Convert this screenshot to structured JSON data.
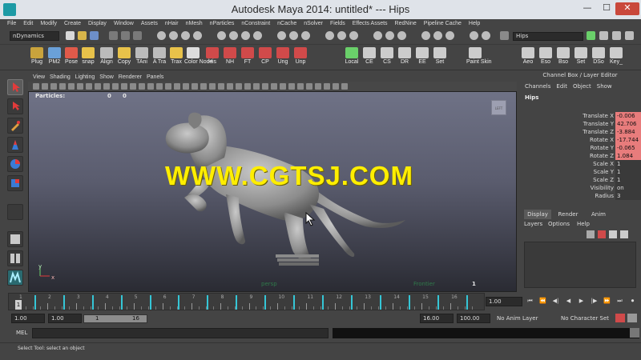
{
  "window": {
    "title": "Autodesk Maya 2014: untitled*   ---   Hips",
    "minimize": "—",
    "maximize": "☐",
    "close": "✕"
  },
  "menu": [
    "File",
    "Edit",
    "Modify",
    "Create",
    "Display",
    "Window",
    "Assets",
    "nHair",
    "nMesh",
    "nParticles",
    "nConstraint",
    "nCache",
    "nSolver",
    "Fields",
    "Effects Assets",
    "RedNine",
    "Pipeline Cache",
    "Help"
  ],
  "status": {
    "mode": "nDynamics",
    "search_value": "Hips"
  },
  "shelf": [
    {
      "label": "Plug",
      "color": "#c9a33c"
    },
    {
      "label": "PM2",
      "color": "#6aa0d8"
    },
    {
      "label": "Pose",
      "color": "#e05a4a"
    },
    {
      "label": "snap",
      "color": "#e8c24a"
    },
    {
      "label": "Align",
      "color": "#bbbbbb"
    },
    {
      "label": "Copy",
      "color": "#e8c24a"
    },
    {
      "label": "TAni",
      "color": "#bbbbbb"
    },
    {
      "label": "A Tra",
      "color": "#bbbbbb"
    },
    {
      "label": "Trax",
      "color": "#e8c24a"
    },
    {
      "label": "Color Node",
      "color": "#dddddd"
    },
    {
      "label": "His",
      "color": "#d04a4a"
    },
    {
      "label": "NH",
      "color": "#d04a4a"
    },
    {
      "label": "FT",
      "color": "#d04a4a"
    },
    {
      "label": "CP",
      "color": "#d04a4a"
    },
    {
      "label": "Ung",
      "color": "#d04a4a"
    },
    {
      "label": "Unp",
      "color": "#d04a4a"
    },
    {
      "label": "Local",
      "color": "#6ad06a"
    },
    {
      "label": "CE",
      "color": "#cccccc"
    },
    {
      "label": "CS",
      "color": "#cccccc"
    },
    {
      "label": "DR",
      "color": "#cccccc"
    },
    {
      "label": "EE",
      "color": "#cccccc"
    },
    {
      "label": "Set",
      "color": "#cccccc"
    },
    {
      "label": "Paint Skin",
      "color": "#cccccc"
    },
    {
      "label": "Aeo",
      "color": "#cccccc"
    },
    {
      "label": "Eso",
      "color": "#cccccc"
    },
    {
      "label": "Bso",
      "color": "#cccccc"
    },
    {
      "label": "Set",
      "color": "#cccccc"
    },
    {
      "label": "DSo",
      "color": "#cccccc"
    },
    {
      "label": "Key_",
      "color": "#cccccc"
    }
  ],
  "panel_menu": [
    "View",
    "Shading",
    "Lighting",
    "Show",
    "Renderer",
    "Panels"
  ],
  "viewport": {
    "particles_label": "Particles:",
    "particles_val1": "0",
    "particles_val2": "0",
    "persp_label": "persp",
    "frontier_label": "Frontier",
    "frame_num": "1",
    "watermark": "WWW.CGTSJ.COM",
    "cube_label": "LEFT",
    "axis_y": "y",
    "axis_x": "x"
  },
  "channel_box": {
    "title": "Channel Box / Layer Editor",
    "menu": [
      "Channels",
      "Edit",
      "Object",
      "Show"
    ],
    "object": "Hips",
    "attributes": [
      {
        "name": "Translate X",
        "value": "-0.006",
        "keyed": true
      },
      {
        "name": "Translate Y",
        "value": "42.706",
        "keyed": true
      },
      {
        "name": "Translate Z",
        "value": "-3.884",
        "keyed": true
      },
      {
        "name": "Rotate X",
        "value": "-17.744",
        "keyed": true
      },
      {
        "name": "Rotate Y",
        "value": "-0.065",
        "keyed": true
      },
      {
        "name": "Rotate Z",
        "value": "1.084",
        "keyed": true
      },
      {
        "name": "Scale X",
        "value": "1",
        "keyed": false
      },
      {
        "name": "Scale Y",
        "value": "1",
        "keyed": false
      },
      {
        "name": "Scale Z",
        "value": "1",
        "keyed": false
      },
      {
        "name": "Visibility",
        "value": "on",
        "keyed": false
      },
      {
        "name": "Radius",
        "value": "3",
        "keyed": false
      }
    ]
  },
  "layer_editor": {
    "tabs": [
      "Display",
      "Render",
      "Anim"
    ],
    "menu": [
      "Layers",
      "Options",
      "Help"
    ]
  },
  "timeline": {
    "numbers": [
      "1",
      "2",
      "3",
      "4",
      "5",
      "6",
      "7",
      "8",
      "9",
      "10",
      "11",
      "12",
      "13",
      "14",
      "15",
      "16"
    ],
    "current_frame": "1",
    "end_field": "1.00",
    "keys": [
      1,
      2,
      3,
      4,
      5,
      6,
      7,
      8,
      9,
      10,
      11,
      12,
      13,
      14,
      15,
      16
    ]
  },
  "range": {
    "start": "1.00",
    "anim_start": "1.00",
    "slider_left": "1",
    "slider_right": "16",
    "anim_end": "16.00",
    "end": "100.00",
    "anim_layer": "No Anim Layer",
    "char_set": "No Character Set"
  },
  "cmd": {
    "label": "MEL"
  },
  "help": {
    "text": "Select Tool: select an object"
  }
}
